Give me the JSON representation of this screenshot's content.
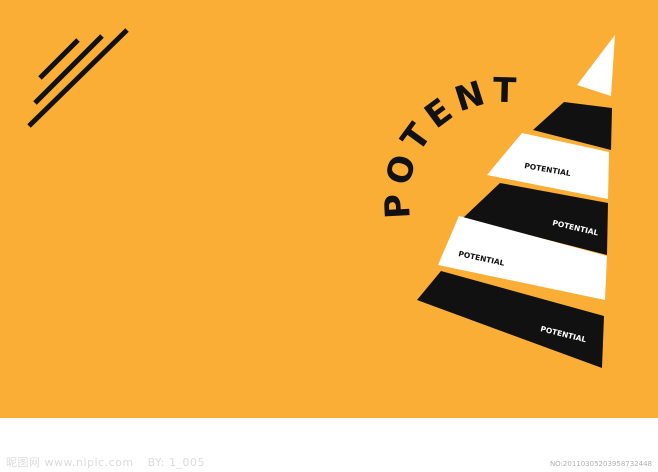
{
  "colors": {
    "background": "#FBAE35",
    "stripe_dark": "#111111",
    "stripe_light": "#FFFFFF",
    "lines": "#111111",
    "footer_bg": "#FFFFFF"
  },
  "poster": {
    "arc_text": "POTENTIAL",
    "stripe_labels": [
      "POTENTIAL",
      "POTENTIAL",
      "POTENTIAL",
      "POTENTIAL"
    ]
  },
  "footer": {
    "watermark_left": "昵图网 www.nipic.com",
    "code_left": "BY: 1_005",
    "id_right": "NO:20110305203958732448"
  }
}
